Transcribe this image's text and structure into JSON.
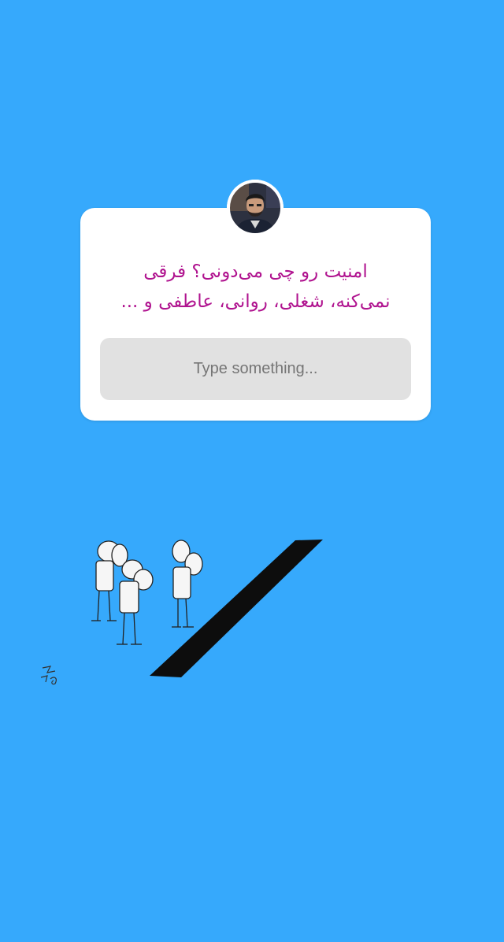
{
  "story": {
    "background_color": "#36a9fc"
  },
  "question_sticker": {
    "text": "امنیت رو چی می‌دونی؟ فرقی\nنمی‌کنه، شغلی، روانی، عاطفی و ...",
    "text_color": "#b0138f",
    "card_color": "#ffffff",
    "answer_placeholder": "Type something...",
    "answer_field_color": "#e1e1e1",
    "avatar_icon": "user-avatar"
  },
  "cartoon": {
    "description_icon": "cartoon-figures-looking-at-dark-gap-icon"
  }
}
